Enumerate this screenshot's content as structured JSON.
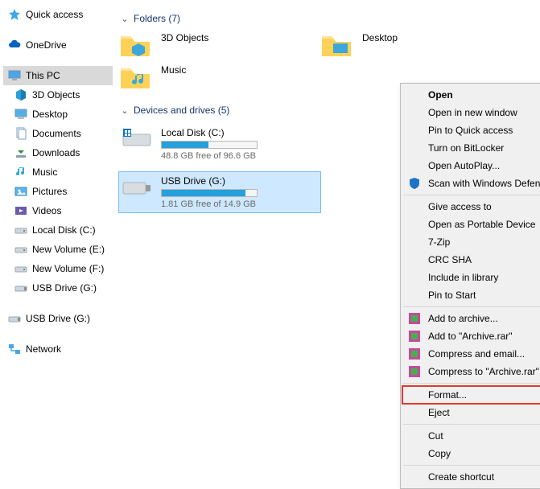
{
  "nav": {
    "quick_access": "Quick access",
    "onedrive": "OneDrive",
    "this_pc": "This PC",
    "objects3d": "3D Objects",
    "desktop": "Desktop",
    "documents": "Documents",
    "downloads": "Downloads",
    "music": "Music",
    "pictures": "Pictures",
    "videos": "Videos",
    "local_disk": "Local Disk (C:)",
    "new_vol_e": "New Volume (E:)",
    "new_vol_f": "New Volume (F:)",
    "usb_g_a": "USB Drive (G:)",
    "usb_g_b": "USB Drive (G:)",
    "network": "Network"
  },
  "sections": {
    "folders": "Folders (7)",
    "drives": "Devices and drives (5)"
  },
  "folders": {
    "objects3d": "3D Objects",
    "desktop": "Desktop",
    "music": "Music"
  },
  "drives": {
    "local": {
      "name": "Local Disk (C:)",
      "free": "48.8 GB free of 96.6 GB",
      "fill_pct": 49
    },
    "usb": {
      "name": "USB Drive (G:)",
      "free": "1.81 GB free of 14.9 GB",
      "fill_pct": 88
    }
  },
  "menu": {
    "open": "Open",
    "open_new": "Open in new window",
    "pin_quick": "Pin to Quick access",
    "bitlocker": "Turn on BitLocker",
    "autoplay": "Open AutoPlay...",
    "defender": "Scan with Windows Defender...",
    "give_access": "Give access to",
    "portable": "Open as Portable Device",
    "sevenzip": "7-Zip",
    "crcsha": "CRC SHA",
    "include_lib": "Include in library",
    "pin_start": "Pin to Start",
    "add_archive": "Add to archive...",
    "add_archive_rar": "Add to \"Archive.rar\"",
    "compress_email": "Compress and email...",
    "compress_rar_email": "Compress to \"Archive.rar\" and email",
    "format": "Format...",
    "eject": "Eject",
    "cut": "Cut",
    "copy": "Copy",
    "create_shortcut": "Create shortcut"
  }
}
